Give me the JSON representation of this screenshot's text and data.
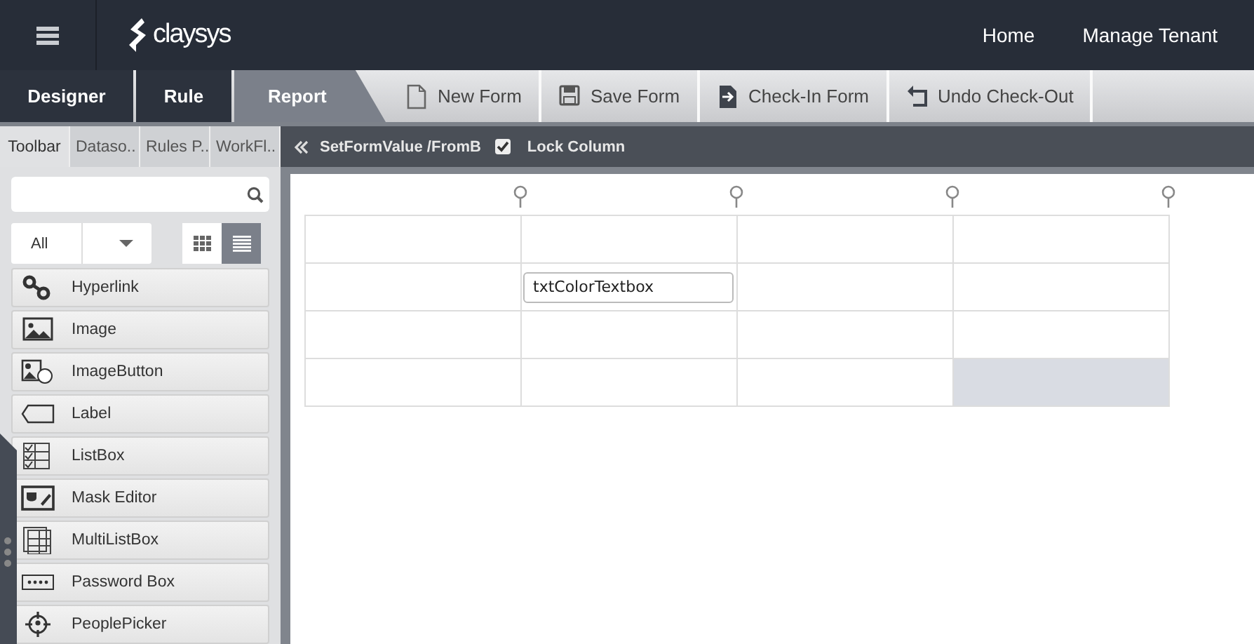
{
  "header": {
    "logo": "claysys",
    "nav": [
      "Home",
      "Manage Tenant"
    ]
  },
  "mode_tabs": [
    {
      "label": "Designer",
      "selected": false
    },
    {
      "label": "Rule",
      "selected": false
    },
    {
      "label": "Report",
      "selected": true
    }
  ],
  "toolbar": [
    "New Form",
    "Save Form",
    "Check-In Form",
    "Undo Check-Out"
  ],
  "panel_tabs": [
    {
      "label": "Toolbar",
      "selected": true
    },
    {
      "label": "Dataso..",
      "selected": false
    },
    {
      "label": "Rules P..",
      "selected": false
    },
    {
      "label": "WorkFl..",
      "selected": false
    }
  ],
  "breadcrumb": {
    "path": "SetFormValue /FromB",
    "lock_column": {
      "label": "Lock Column",
      "checked": true
    }
  },
  "filter": {
    "value": "All"
  },
  "view_toggle": [
    {
      "kind": "grid",
      "selected": false
    },
    {
      "kind": "list",
      "selected": true
    }
  ],
  "controls": [
    "Hyperlink",
    "Image",
    "ImageButton",
    "Label",
    "ListBox",
    "Mask Editor",
    "MultiListBox",
    "Password Box",
    "PeoplePicker"
  ],
  "grid": {
    "rows": [
      {
        "cells": [
          {
            "selected": false
          },
          {
            "selected": false
          },
          {
            "selected": false
          },
          {
            "selected": false
          }
        ]
      },
      {
        "cells": [
          {
            "selected": false
          },
          {
            "selected": false,
            "textbox": "txtColorTextbox"
          },
          {
            "selected": false
          },
          {
            "selected": false
          }
        ]
      },
      {
        "cells": [
          {
            "selected": false
          },
          {
            "selected": false
          },
          {
            "selected": false
          },
          {
            "selected": false
          }
        ]
      },
      {
        "cells": [
          {
            "selected": false
          },
          {
            "selected": false
          },
          {
            "selected": false
          },
          {
            "selected": true
          }
        ]
      }
    ]
  }
}
